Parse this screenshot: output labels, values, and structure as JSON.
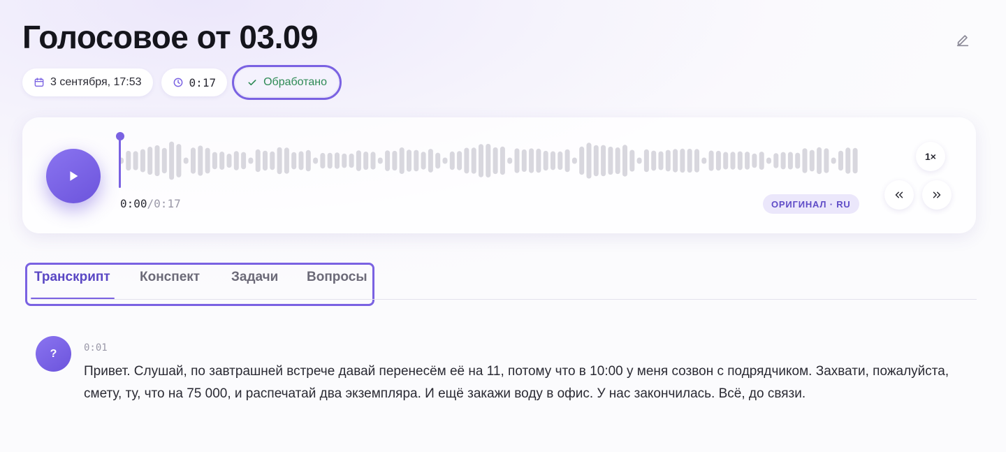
{
  "header": {
    "title": "Голосовое от 03.09",
    "edit_icon": "pencil-icon"
  },
  "meta": {
    "date": "3 сентября, 17:53",
    "date_icon": "calendar-icon",
    "duration": "0:17",
    "duration_icon": "clock-icon",
    "status": "Обработано",
    "status_icon": "check-icon"
  },
  "player": {
    "play_icon": "play-icon",
    "current_time": "0:00",
    "separator": "/",
    "total_time": "0:17",
    "progress": 0,
    "language_badge": "ОРИГИНАЛ · RU",
    "speed": "1×",
    "rewind_icon": "rewind-icon",
    "forward_icon": "fast-forward-icon"
  },
  "tabs": [
    {
      "label": "Транскрипт",
      "active": true
    },
    {
      "label": "Конспект",
      "active": false
    },
    {
      "label": "Задачи",
      "active": false
    },
    {
      "label": "Вопросы",
      "active": false
    }
  ],
  "transcript": [
    {
      "speaker": "?",
      "time": "0:01",
      "text": "Привет. Слушай, по завтрашней встрече давай перенесём её на 11, потому что в 10:00 у меня созвон с подрядчиком. Захвати, пожалуйста, смету, ту, что на 75 000, и распечатай два экземпляра. И ещё закажи воду в офис. У нас закончилась. Всё, до связи."
    }
  ],
  "colors": {
    "accent": "#7a62e2",
    "status_green": "#2e8a55",
    "waveform_bar": "#d8d7de"
  }
}
